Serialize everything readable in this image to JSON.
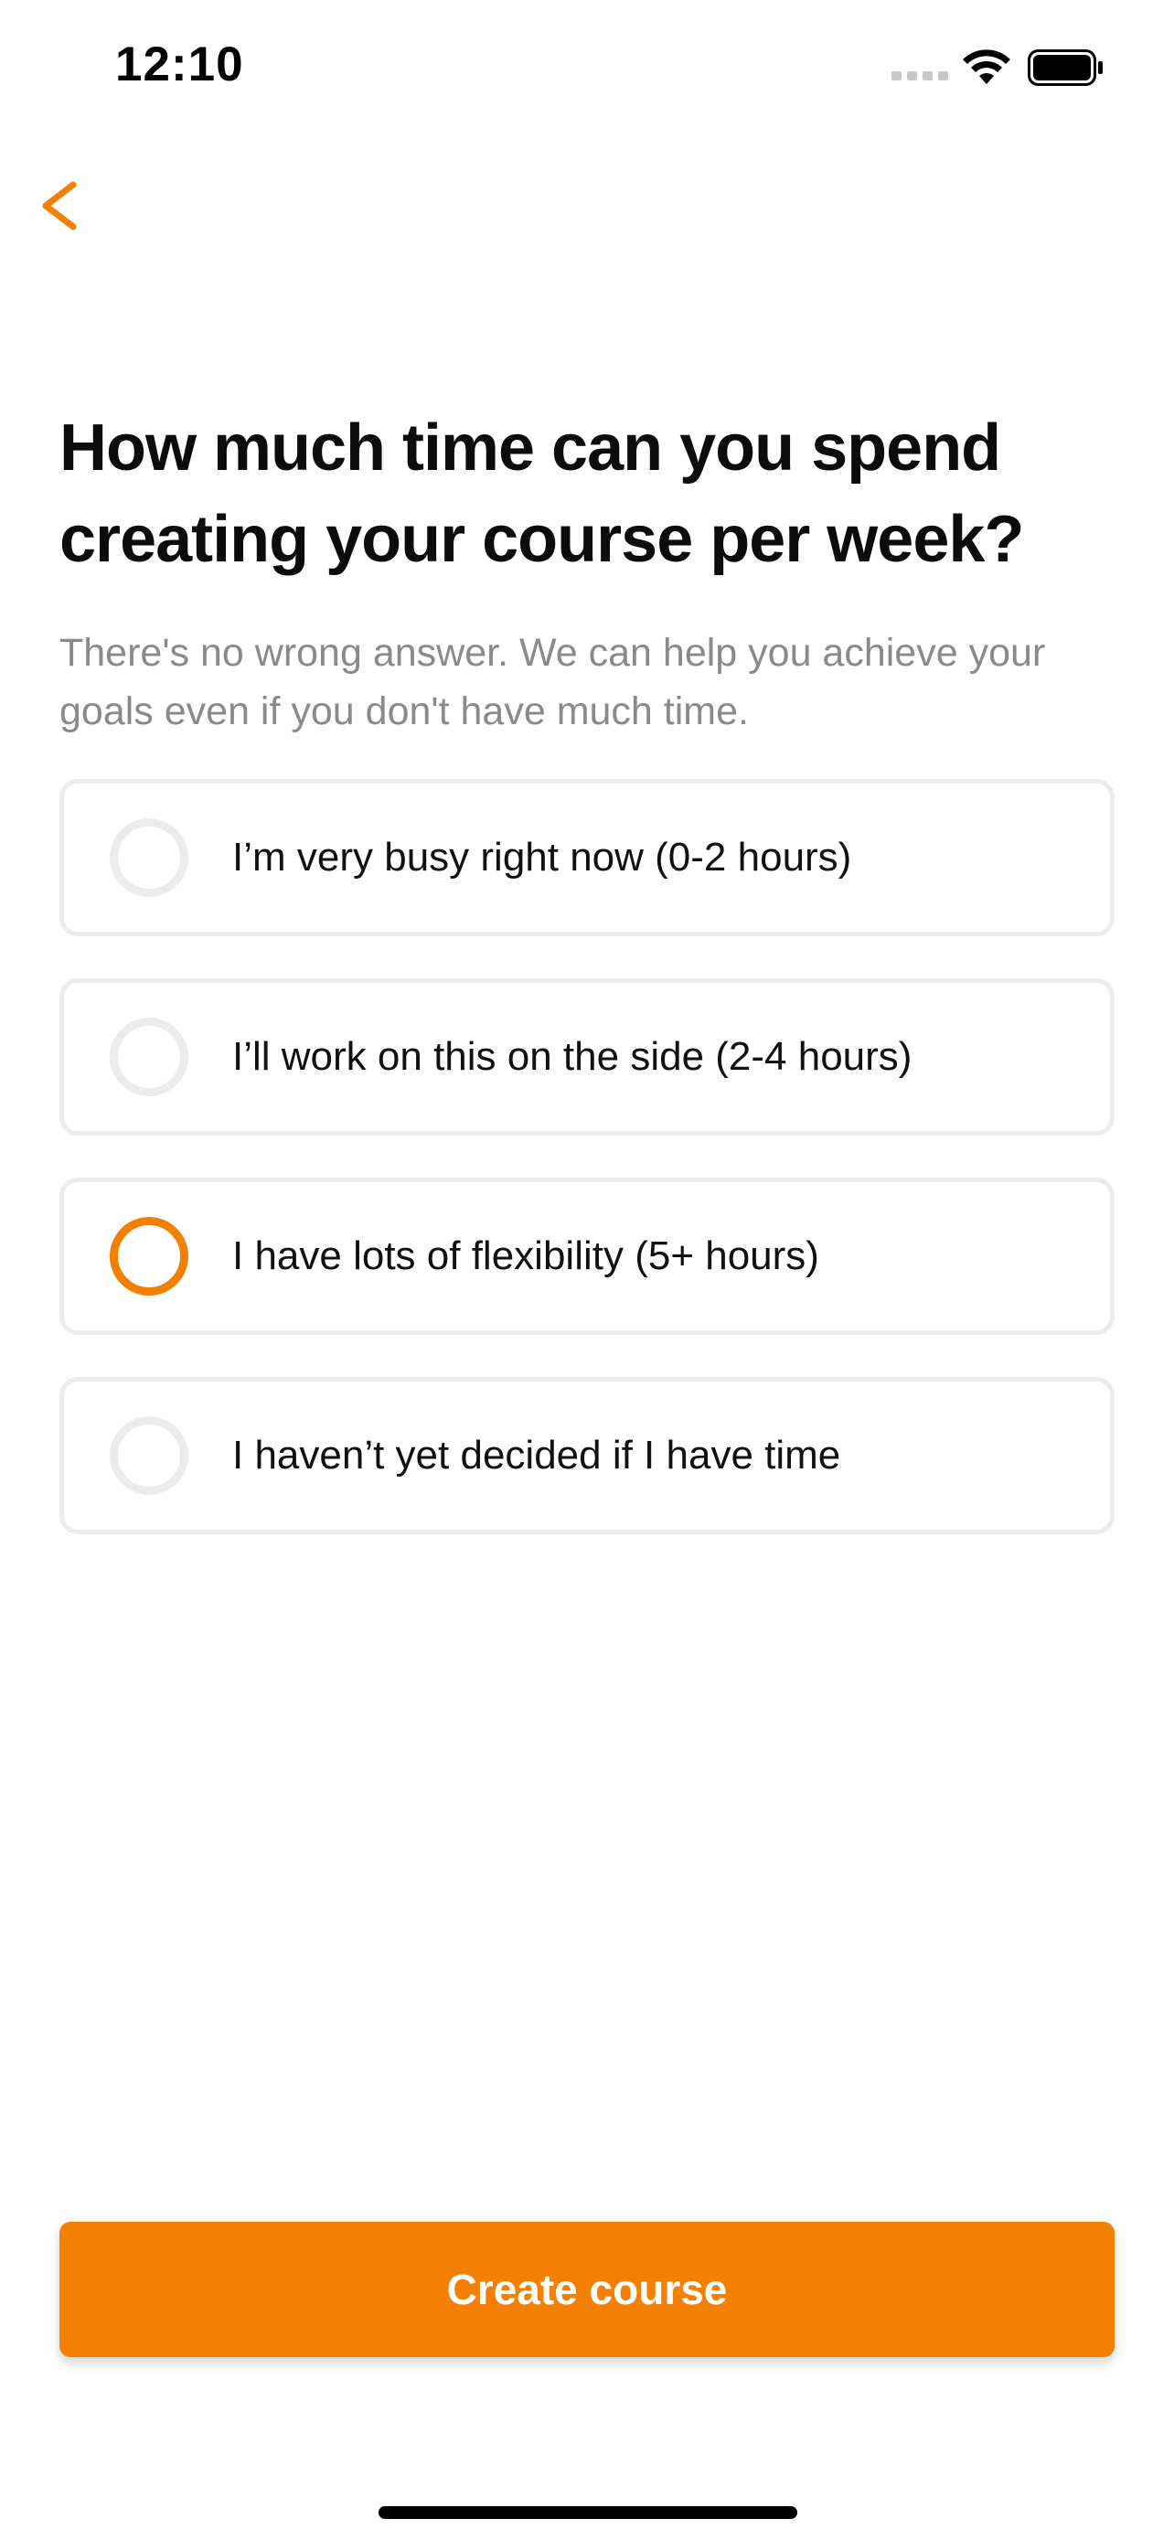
{
  "status_bar": {
    "time": "12:10",
    "icons": [
      "signal-icon",
      "wifi-icon",
      "battery-icon"
    ]
  },
  "navigation": {
    "back_icon": "chevron-left-icon"
  },
  "question": {
    "title": "How much time can you spend creating your course per week?",
    "subtitle": "There's no wrong answer. We can help you achieve your goals even if you don't have much time."
  },
  "options": [
    {
      "label": "I’m very busy right now (0-2 hours)",
      "selected": false
    },
    {
      "label": "I’ll work on this on the side (2-4 hours)",
      "selected": false
    },
    {
      "label": "I have lots of flexibility (5+ hours)",
      "selected": true
    },
    {
      "label": "I haven’t yet decided if I have time",
      "selected": false
    }
  ],
  "actions": {
    "create_label": "Create course"
  },
  "colors": {
    "accent": "#f57f00",
    "option_border": "#ececec",
    "subtitle_text": "#8a8a8a",
    "title_text": "#0c0c0c"
  }
}
